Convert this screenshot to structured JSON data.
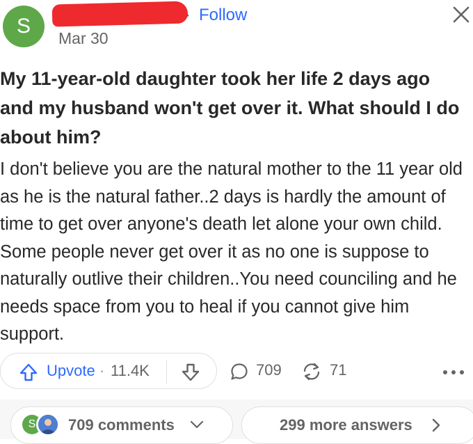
{
  "header": {
    "avatar_letter": "S",
    "follow_separator": "·",
    "follow_label": "Follow",
    "date": "Mar 30",
    "close_icon": "close-icon"
  },
  "question": "My 11-year-old daughter took her life 2 days ago and my husband won't get over it. What should I do about him?",
  "answer": "I don't believe you are the natural mother to the 11 year old as he is the natural father..2 days is hardly the amount of time to get over anyone's death let alone your own child. Some people never get over it as no one is suppose to naturally outlive their children..You need counciling and he needs space from you to heal if you cannot give him support.",
  "actions": {
    "upvote_label": "Upvote",
    "upvote_separator": "·",
    "upvote_count": "11.4K",
    "comment_count": "709",
    "share_count": "71"
  },
  "footer": {
    "avatar_letter": "S",
    "comments_label": "709 comments",
    "more_answers_label": "299 more answers"
  },
  "colors": {
    "accent_blue": "#2e69ff",
    "avatar_green": "#5ea84a",
    "text_dark": "#282829",
    "text_muted": "#636466",
    "redaction_red": "#ee2a2f"
  }
}
